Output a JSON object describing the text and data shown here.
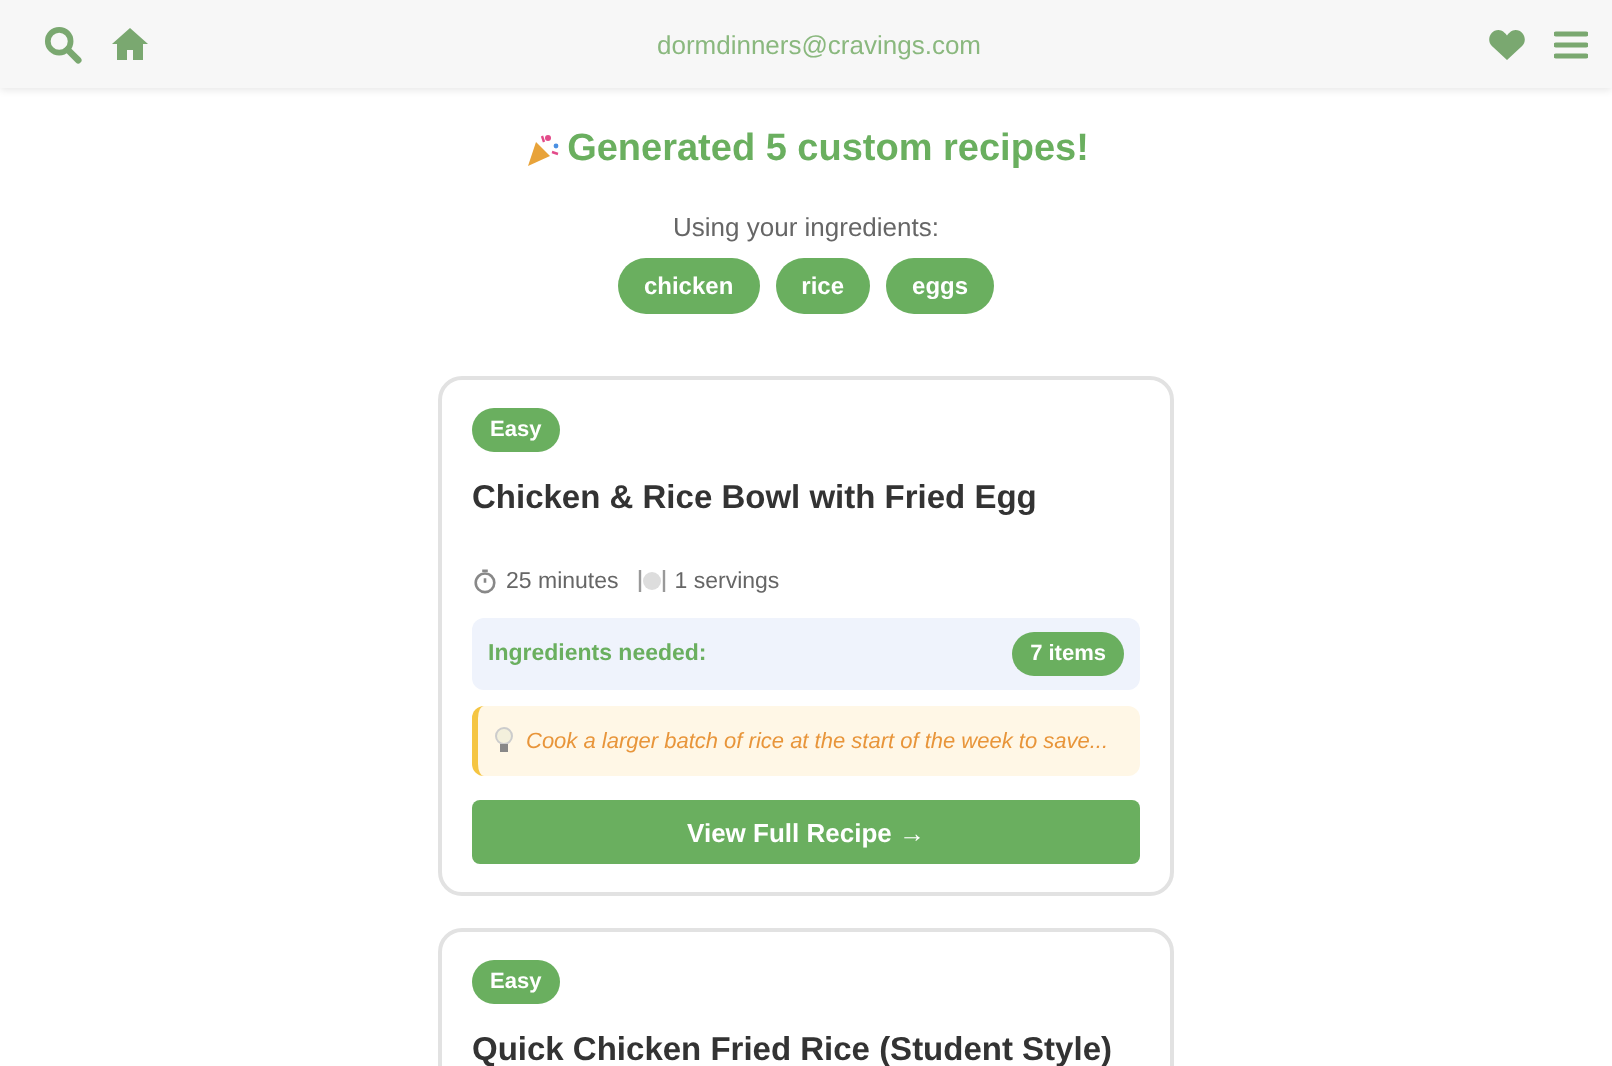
{
  "header": {
    "email": "dormdinners@cravings.com"
  },
  "heading": "Generated 5 custom recipes!",
  "ingredients_label": "Using your ingredients:",
  "ingredients": [
    "chicken",
    "rice",
    "eggs"
  ],
  "recipes": [
    {
      "difficulty": "Easy",
      "title": "Chicken & Rice Bowl with Fried Egg",
      "time": "25 minutes",
      "servings": "1 servings",
      "ingredients_label": "Ingredients needed:",
      "ingredients_count": "7 items",
      "tip": "Cook a larger batch of rice at the start of the week to save...",
      "button": "View Full Recipe →"
    },
    {
      "difficulty": "Easy",
      "title": "Quick Chicken Fried Rice (Student Style)"
    }
  ]
}
